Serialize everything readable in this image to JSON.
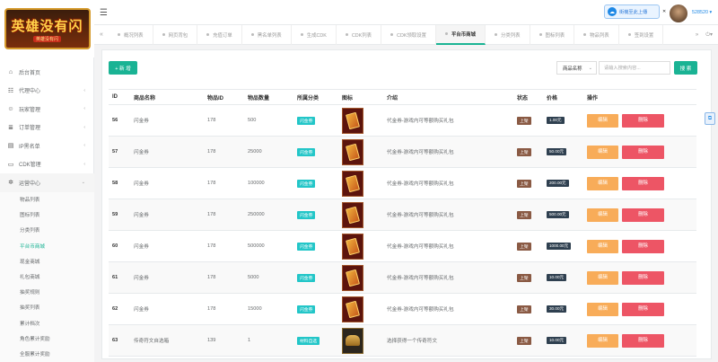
{
  "logo": {
    "title": "英雄没有闪",
    "subtitle": "英雄没有闪"
  },
  "sidebar": {
    "items": [
      {
        "label": "后台首页",
        "icon": "home-icon",
        "glyph": "⌂"
      },
      {
        "label": "代理中心",
        "icon": "users-icon",
        "glyph": "☷",
        "arrow": "‹"
      },
      {
        "label": "玩家管理",
        "icon": "user-icon",
        "glyph": "☺",
        "arrow": "‹"
      },
      {
        "label": "订单管理",
        "icon": "list-icon",
        "glyph": "≣",
        "arrow": "‹"
      },
      {
        "label": "IP黑名单",
        "icon": "file-icon",
        "glyph": "▤",
        "arrow": "‹"
      },
      {
        "label": "CDK管理",
        "icon": "folder-icon",
        "glyph": "▭",
        "arrow": "‹"
      },
      {
        "label": "运营中心",
        "icon": "gear-icon",
        "glyph": "✲",
        "arrow": "⌄"
      }
    ],
    "sub_items": [
      "物品列表",
      "图标列表",
      "分类列表",
      "平台币商城",
      "现金商城",
      "礼包商城",
      "抽奖规则",
      "抽奖列表",
      "累计档次",
      "角色累计奖励",
      "全服累计奖励"
    ],
    "active_sub": "平台币商城"
  },
  "topbar": {
    "hamburger": "☰",
    "upload_label": "街機至此上傳",
    "close": "✕",
    "username": "528520 ▾"
  },
  "tabs": {
    "prev": "«",
    "next": "»",
    "items": [
      "概况列表",
      "网页背包",
      "充值订单",
      "黑名单列表",
      "生成CDK",
      "CDK列表",
      "CDK领取设置",
      "平台币商城",
      "分类列表",
      "图标列表",
      "物品列表",
      "签到设置"
    ],
    "active": "平台币商城",
    "right_icons": [
      "»",
      "⏻▾"
    ]
  },
  "toolbar": {
    "add_label": "+ 新 增",
    "filter_value": "商品名称",
    "filter_caret": "⌄",
    "search_placeholder": "请输入搜索内容...",
    "search_label": "搜 索"
  },
  "table": {
    "columns": [
      "ID",
      "商品名称",
      "物品ID",
      "物品数量",
      "所属分类",
      "图标",
      "介绍",
      "状态",
      "价格",
      "操作"
    ],
    "edit_label": "编辑",
    "delete_label": "删除",
    "rows": [
      {
        "id": "56",
        "name": "闪金券",
        "item_id": "178",
        "qty": "500",
        "category": "闪金券",
        "icon": "card",
        "desc": "代金券-游戏内可等额购买礼包",
        "status": "上架",
        "price": "1.00元"
      },
      {
        "id": "57",
        "name": "闪金券",
        "item_id": "178",
        "qty": "25000",
        "category": "闪金券",
        "icon": "card",
        "desc": "代金券-游戏内可等额购买礼包",
        "status": "上架",
        "price": "50.00元"
      },
      {
        "id": "58",
        "name": "闪金券",
        "item_id": "178",
        "qty": "100000",
        "category": "闪金券",
        "icon": "card",
        "desc": "代金券-游戏内可等额购买礼包",
        "status": "上架",
        "price": "200.00元"
      },
      {
        "id": "59",
        "name": "闪金券",
        "item_id": "178",
        "qty": "250000",
        "category": "闪金券",
        "icon": "card",
        "desc": "代金券-游戏内可等额购买礼包",
        "status": "上架",
        "price": "500.00元"
      },
      {
        "id": "60",
        "name": "闪金券",
        "item_id": "178",
        "qty": "500000",
        "category": "闪金券",
        "icon": "card",
        "desc": "代金券-游戏内可等额购买礼包",
        "status": "上架",
        "price": "1000.00元"
      },
      {
        "id": "61",
        "name": "闪金券",
        "item_id": "178",
        "qty": "5000",
        "category": "闪金券",
        "icon": "card",
        "desc": "代金券-游戏内可等额购买礼包",
        "status": "上架",
        "price": "10.00元"
      },
      {
        "id": "62",
        "name": "闪金券",
        "item_id": "178",
        "qty": "15000",
        "category": "闪金券",
        "icon": "card",
        "desc": "代金券-游戏内可等额购买礼包",
        "status": "上架",
        "price": "30.00元"
      },
      {
        "id": "63",
        "name": "传奇符文自选箱",
        "item_id": "139",
        "qty": "1",
        "category": "材料自选",
        "icon": "chest",
        "desc": "选择获得一个传奇符文",
        "status": "上架",
        "price": "10.00元"
      }
    ]
  },
  "floating_glyph": "⧉",
  "colors": {
    "primary": "#1ab394",
    "warning": "#f8ac59",
    "danger": "#ed5565",
    "info": "#23c6c8",
    "dark": "#2f4050"
  }
}
